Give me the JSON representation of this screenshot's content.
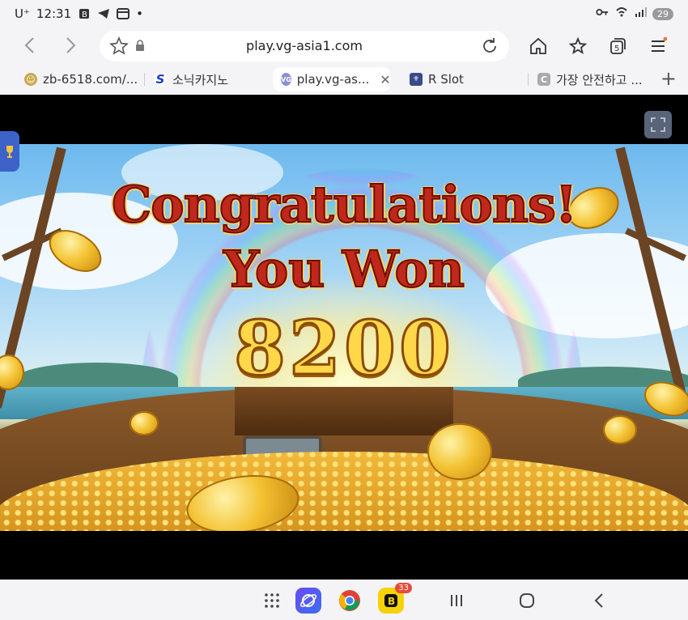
{
  "status_bar": {
    "carrier": "U⁺",
    "time": "12:31",
    "dot": "•",
    "battery": "29"
  },
  "address_bar": {
    "url": "play.vg-asia1.com",
    "tab_count": "5"
  },
  "tabs": [
    {
      "label": "zb-6518.com/...",
      "favicon": "zb-favicon"
    },
    {
      "label": "소닉카지노",
      "favicon": "S"
    },
    {
      "label": "play.vg-as...",
      "favicon": "VG",
      "active": true
    },
    {
      "label": "R Slot",
      "favicon": "r-slot-favicon"
    },
    {
      "label": "가장 안전하고 ...",
      "favicon": "C"
    }
  ],
  "game": {
    "line1": "Congratulations!",
    "line2": "You Won",
    "amount": "8200"
  },
  "bottom_nav": {
    "dock_badge": "33"
  },
  "colors": {
    "accent": "#e8763a",
    "title_red": "#c0281c",
    "gold": "#ffd84a",
    "bg": "#f4f4f6"
  }
}
